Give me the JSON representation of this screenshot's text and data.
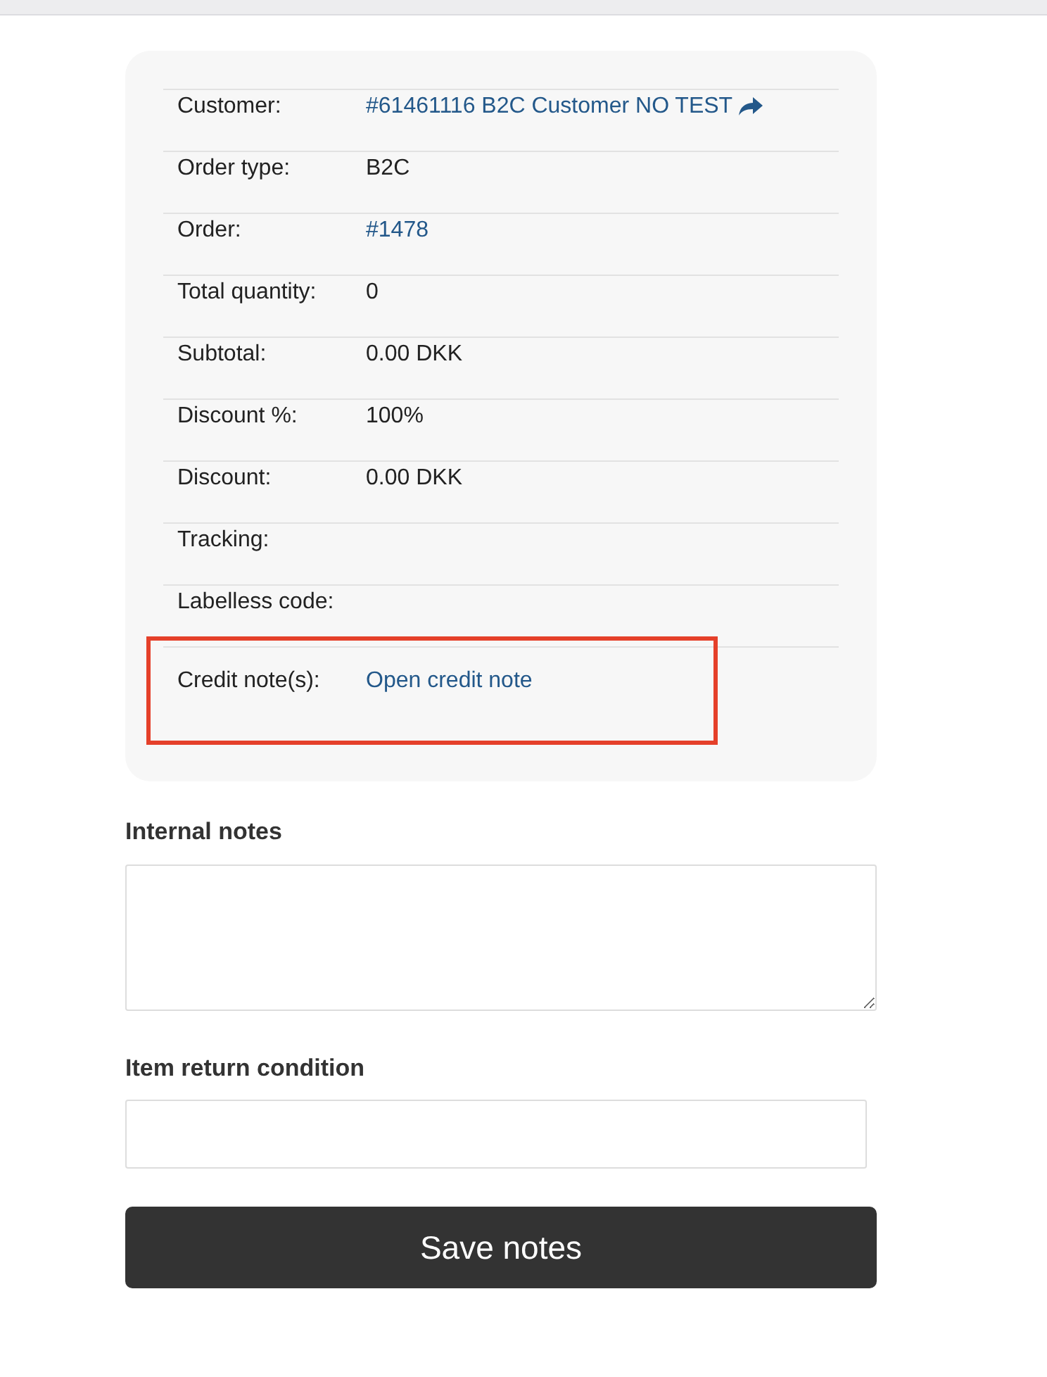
{
  "details": [
    {
      "label": "Customer:",
      "kind": "external-link",
      "value": "#61461116 B2C Customer NO TEST",
      "highlighted": false
    },
    {
      "label": "Order type:",
      "kind": "text",
      "value": "B2C",
      "highlighted": false
    },
    {
      "label": "Order:",
      "kind": "link",
      "value": "#1478",
      "highlighted": false
    },
    {
      "label": "Total quantity:",
      "kind": "text",
      "value": "0",
      "highlighted": false
    },
    {
      "label": "Subtotal:",
      "kind": "text",
      "value": "0.00 DKK",
      "highlighted": false
    },
    {
      "label": "Discount %:",
      "kind": "text",
      "value": "100%",
      "highlighted": false
    },
    {
      "label": "Discount:",
      "kind": "text",
      "value": "0.00 DKK",
      "highlighted": false
    },
    {
      "label": "Tracking:",
      "kind": "text",
      "highlighted": false
    },
    {
      "label": "Labelless code:",
      "kind": "text",
      "highlighted": false
    },
    {
      "label": "Credit note(s):",
      "kind": "link",
      "value": "Open credit note",
      "highlighted": true
    }
  ],
  "internal_notes": {
    "label": "Internal notes"
  },
  "item_return_condition": {
    "label": "Item return condition"
  },
  "save_button": "Save notes"
}
